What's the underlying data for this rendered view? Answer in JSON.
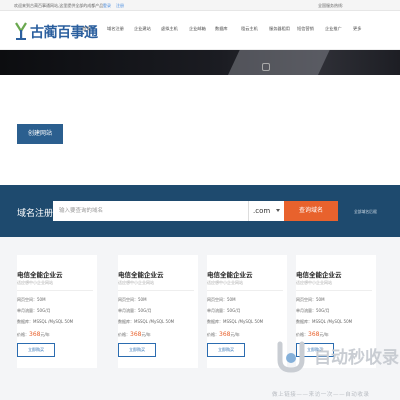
{
  "topbar": {
    "welcome": "欢迎来到古蔺百事通网站,这里提供全部的成都产品!",
    "login": "登录",
    "register": "注册",
    "hotline_label": "全国服务热线:",
    "hotline": "0830-7880112"
  },
  "header": {
    "logo_text": "古蔺百事通",
    "nav": [
      "首页",
      "域名注册",
      "企业建站",
      "虚拟主机",
      "企业邮箱",
      "数据库",
      "租云主机",
      "服务器租用",
      "短信营销",
      "企业推广",
      "更多"
    ]
  },
  "hero": {
    "button_label": "创建网站"
  },
  "domain": {
    "title": "域名注册",
    "placeholder": "输入要查询的域名",
    "suffix": ".com",
    "search_label": "查询域名",
    "fullsearch": "全部域名后缀"
  },
  "cards": [
    {
      "title": "电信全能企业云",
      "subtitle": "适应想中小企业网站",
      "space": "网页空间：50M",
      "traffic": "单月流量：50G/月",
      "db": "数据库：MSSQL /MySQL 50M",
      "price_label": "价格：",
      "price": "368",
      "price_unit": "元/年",
      "buy": "立即购买"
    },
    {
      "title": "电信全能企业云",
      "subtitle": "适应想中小企业网站",
      "space": "网页空间：50M",
      "traffic": "单月流量：50G/月",
      "db": "数据库：MSSQL /MySQL 50M",
      "price_label": "价格：",
      "price": "368",
      "price_unit": "元/年",
      "buy": "立即购买"
    },
    {
      "title": "电信全能企业云",
      "subtitle": "适应想中小企业网站",
      "space": "网页空间：50M",
      "traffic": "单月流量：50G/月",
      "db": "数据库：MSSQL /MySQL 50M",
      "price_label": "价格：",
      "price": "368",
      "price_unit": "元/年",
      "buy": "立即购买"
    },
    {
      "title": "电信全能企业云",
      "subtitle": "适应想中小企业网站",
      "space": "网页空间：50M",
      "traffic": "单月流量：50G/月",
      "db": "数据库：MSSQL /MySQL 50M",
      "price_label": "价格：",
      "price": "368",
      "price_unit": "元/年",
      "buy": "立即购买"
    }
  ],
  "watermark": {
    "text": "自动秒收录",
    "sub": "做上链接——来访一次——自动收录"
  },
  "colors": {
    "brand": "#2b5f9e",
    "accent": "#e8622d",
    "domain_bar": "#1e4a6e"
  }
}
